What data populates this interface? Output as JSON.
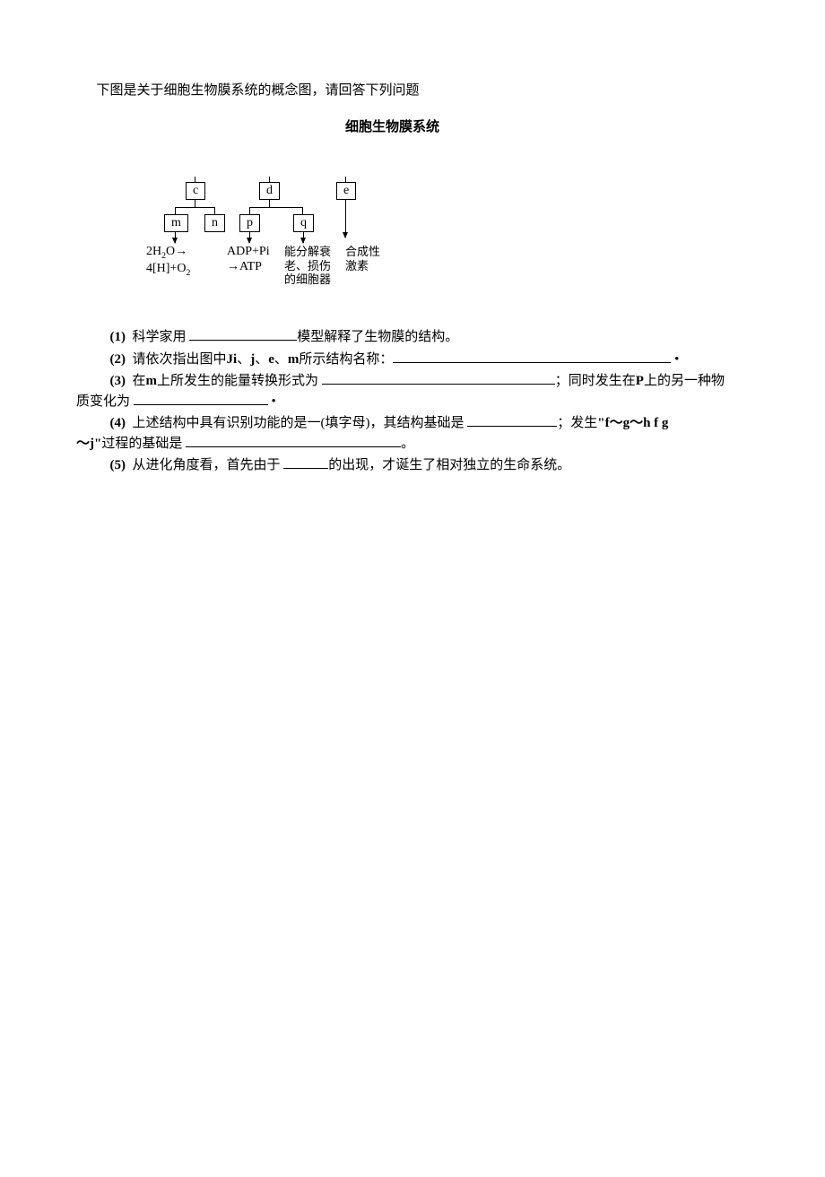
{
  "intro": "下图是关于细胞生物膜系统的概念图，请回答下列问题",
  "diagram": {
    "title": "细胞生物膜系统",
    "boxes": {
      "c": "c",
      "d": "d",
      "e": "e",
      "m": "m",
      "n": "n",
      "p": "p",
      "q": "q"
    },
    "labels": {
      "m_line1": "2H₂O→",
      "m_line2": "4[H]+O₂",
      "p_line1": "ADP+Pi",
      "p_line2": "→ATP",
      "q_line1": "能分解衰",
      "q_line2": "老、损伤",
      "q_line3": "的细胞器",
      "e_line1": "合成性",
      "e_line2": "激素"
    }
  },
  "q1": {
    "num": "(1)",
    "t1": "科学家用 ",
    "t2": "模型解释了生物膜的结构。"
  },
  "q2": {
    "num": "(2)",
    "t1": "请依次指出图中",
    "ji": "Ji",
    "sep1": "、",
    "j": "j",
    "sep2": "、",
    "e": "e",
    "sep3": "、",
    "m": "m",
    "t2": "所示结构名称：",
    "end": "•"
  },
  "q3": {
    "num": "(3)",
    "t1": "在",
    "m": "m",
    "t2": "上所发生的能量转换形式为 ",
    "t3": "；同时发生在",
    "p": "P",
    "t4": "上的另一种物",
    "cont": "质变化为 ",
    "end": "•"
  },
  "q4": {
    "num": "(4)",
    "t1": "上述结构中具有识别功能的是一(填字母)，其结构基础是 ",
    "t2": "；发生",
    "quote": "\"f～g～h f g",
    "cont1": "～j\"",
    "cont2": "过程的基础是 ",
    "end": "。"
  },
  "q5": {
    "num": "(5)",
    "t1": "从进化角度看，首先由于 ",
    "t2": "的出现，才诞生了相对独立的生命系统。"
  }
}
